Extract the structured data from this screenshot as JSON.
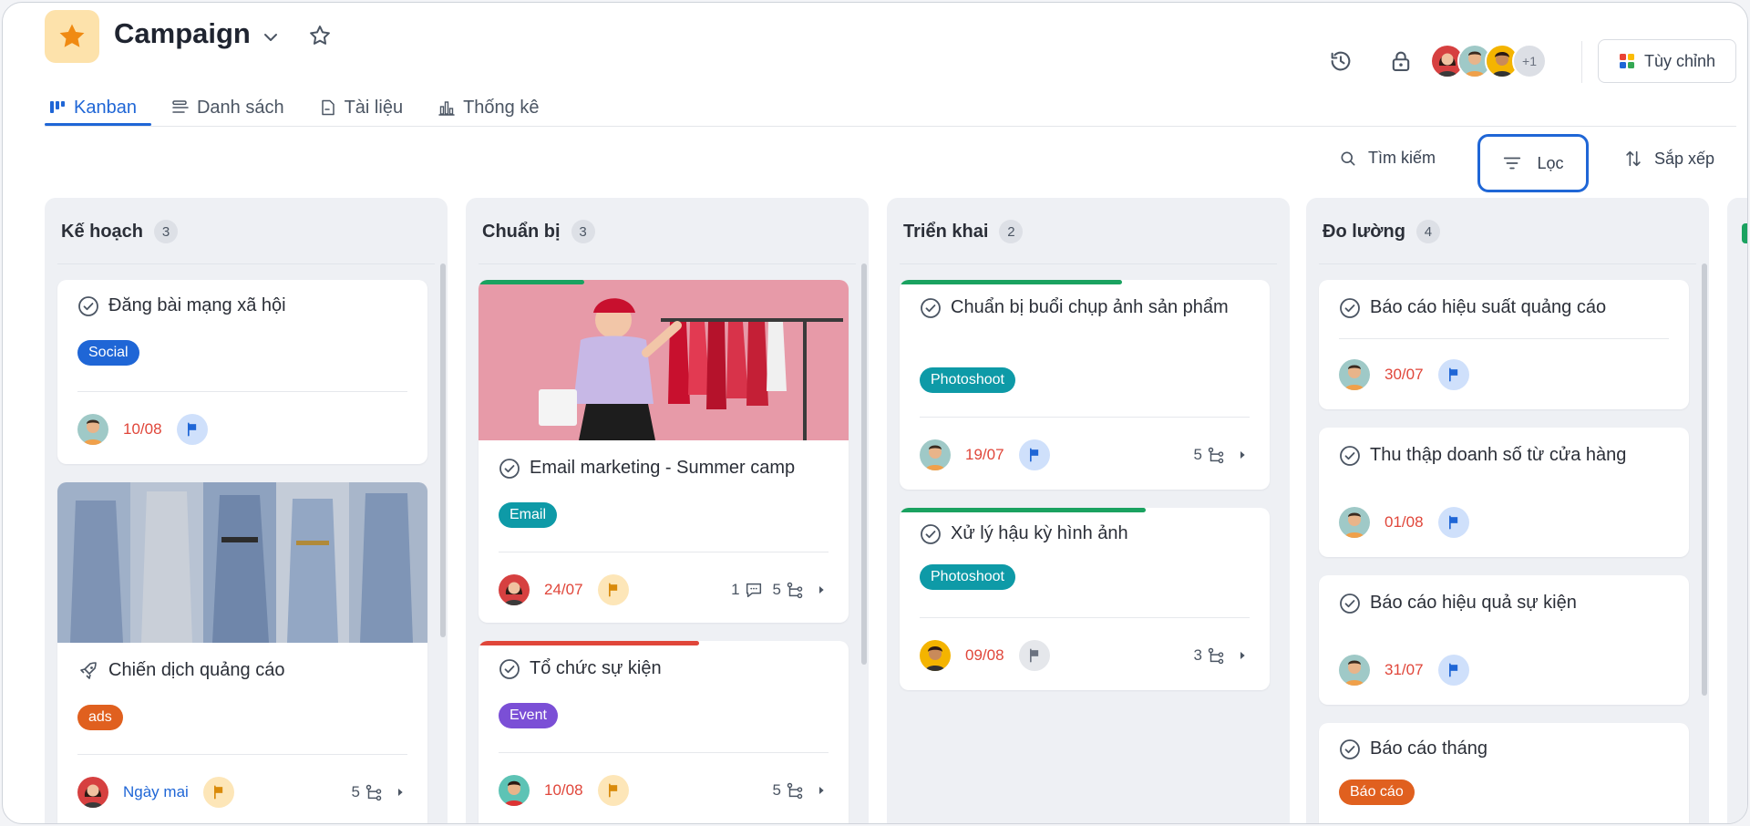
{
  "header": {
    "title": "Campaign",
    "extra_members": "+1",
    "customize_label": "Tùy chỉnh"
  },
  "tabs": [
    {
      "label": "Kanban",
      "icon": "kanban-icon",
      "active": true
    },
    {
      "label": "Danh sách",
      "icon": "list-icon",
      "active": false
    },
    {
      "label": "Tài liệu",
      "icon": "document-icon",
      "active": false
    },
    {
      "label": "Thống kê",
      "icon": "chart-icon",
      "active": false
    }
  ],
  "toolbar": {
    "search_label": "Tìm kiếm",
    "filter_label": "Lọc",
    "sort_label": "Sắp xếp"
  },
  "colors": {
    "accent": "#1f66d6",
    "overdue": "#e0463a",
    "tag_social": "#1f66d6",
    "tag_ads": "#e0601f",
    "tag_email": "#0e9aa7",
    "tag_photoshoot": "#0e9aa7",
    "tag_event": "#7b4fd6",
    "tag_report": "#e0601f"
  },
  "columns": [
    {
      "title": "Kế hoạch",
      "count": "3",
      "cards": [
        {
          "title": "Đăng bài mạng xã hội",
          "tag": "Social",
          "date": "10/08"
        },
        {
          "title": "Chiến dịch quảng cáo",
          "tag": "ads",
          "date": "Ngày mai",
          "subtasks": "5"
        }
      ]
    },
    {
      "title": "Chuẩn bị",
      "count": "3",
      "cards": [
        {
          "title": "Email marketing - Summer camp",
          "tag": "Email",
          "date": "24/07",
          "comments": "1",
          "subtasks": "5"
        },
        {
          "title": "Tổ chức sự kiện",
          "tag": "Event",
          "date": "10/08",
          "subtasks": "5"
        }
      ]
    },
    {
      "title": "Triển khai",
      "count": "2",
      "cards": [
        {
          "title": "Chuẩn bị buổi chụp ảnh sản phẩm",
          "tag": "Photoshoot",
          "date": "19/07",
          "subtasks": "5"
        },
        {
          "title": "Xử lý hậu kỳ hình ảnh",
          "tag": "Photoshoot",
          "date": "09/08",
          "subtasks": "3"
        }
      ]
    },
    {
      "title": "Đo lường",
      "count": "4",
      "cards": [
        {
          "title": "Báo cáo hiệu suất quảng cáo",
          "date": "30/07"
        },
        {
          "title": "Thu thập doanh số từ cửa hàng",
          "date": "01/08"
        },
        {
          "title": "Báo cáo hiệu quả sự kiện",
          "date": "31/07"
        },
        {
          "title": "Báo cáo tháng",
          "tag": "Báo cáo"
        }
      ]
    }
  ]
}
